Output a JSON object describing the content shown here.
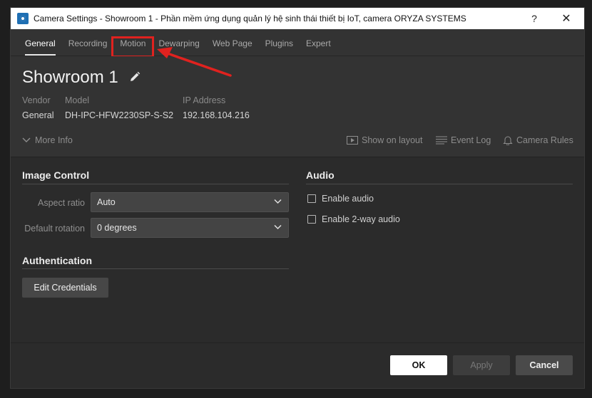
{
  "window": {
    "title": "Camera Settings - Showroom 1 - Phần mềm ứng dụng quản lý hệ sinh thái thiết bị IoT, camera ORYZA SYSTEMS",
    "help": "?",
    "close": "✕"
  },
  "tabs": [
    {
      "label": "General",
      "active": true
    },
    {
      "label": "Recording"
    },
    {
      "label": "Motion",
      "highlighted": true
    },
    {
      "label": "Dewarping"
    },
    {
      "label": "Web Page"
    },
    {
      "label": "Plugins"
    },
    {
      "label": "Expert"
    }
  ],
  "camera": {
    "name": "Showroom 1",
    "vendor_label": "Vendor",
    "vendor": "General",
    "model_label": "Model",
    "model": "DH-IPC-HFW2230SP-S-S2",
    "ip_label": "IP Address",
    "ip": "192.168.104.216"
  },
  "header_actions": {
    "more_info": "More Info",
    "show_on_layout": "Show on layout",
    "event_log": "Event Log",
    "camera_rules": "Camera Rules"
  },
  "image_control": {
    "title": "Image Control",
    "aspect_label": "Aspect ratio",
    "aspect_value": "Auto",
    "rotation_label": "Default rotation",
    "rotation_value": "0 degrees"
  },
  "audio": {
    "title": "Audio",
    "enable_audio": "Enable audio",
    "enable_2way": "Enable 2-way audio"
  },
  "authentication": {
    "title": "Authentication",
    "edit_credentials": "Edit Credentials"
  },
  "footer": {
    "ok": "OK",
    "apply": "Apply",
    "cancel": "Cancel"
  },
  "annotation": {
    "color": "#e0221f"
  }
}
